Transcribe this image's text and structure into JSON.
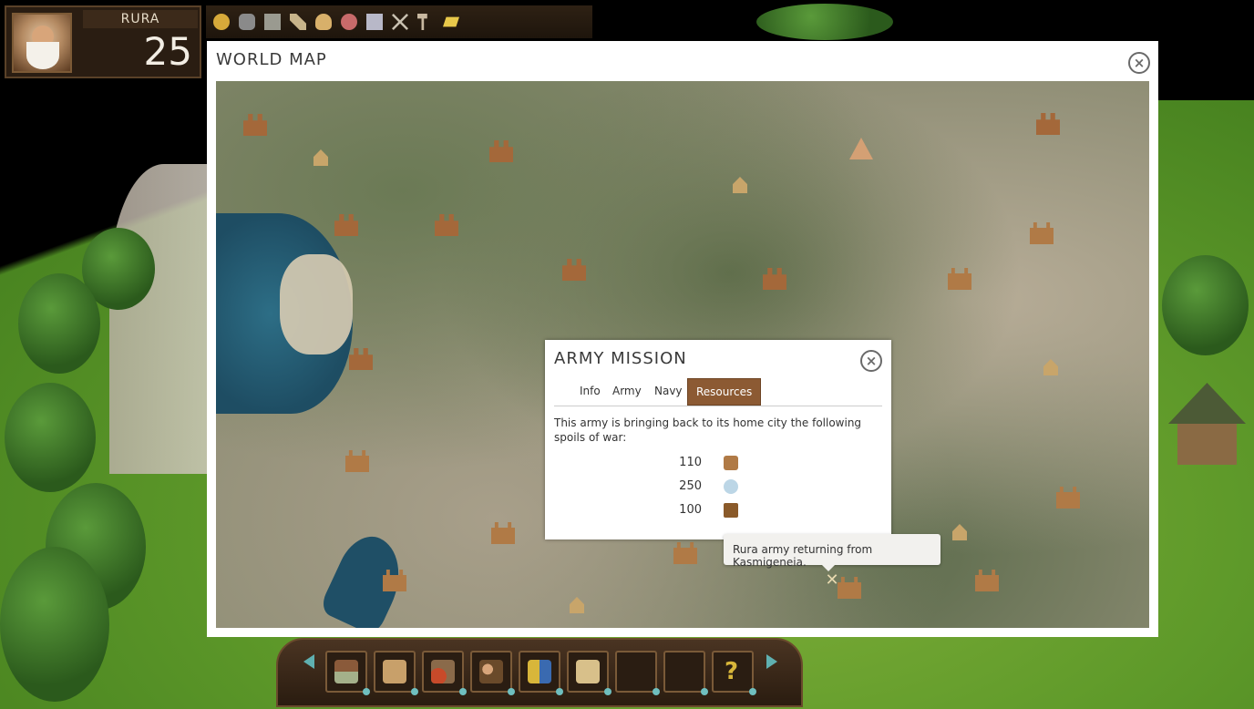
{
  "player": {
    "name": "RURA",
    "level": "25"
  },
  "resources": [
    {
      "icon": "gold-ore-icon",
      "color": "#d6a93a"
    },
    {
      "icon": "iron-ore-icon",
      "color": "#8a8a8a"
    },
    {
      "icon": "stone-icon",
      "color": "#9a9a90"
    },
    {
      "icon": "tools-icon",
      "color": "#c8b48a"
    },
    {
      "icon": "bread-icon",
      "color": "#d8b06a"
    },
    {
      "icon": "meat-icon",
      "color": "#c86a6a"
    },
    {
      "icon": "cloth-icon",
      "color": "#b8b8c8"
    },
    {
      "icon": "swords-icon",
      "color": "#c8c0b0"
    },
    {
      "icon": "hammer-icon",
      "color": "#c8b8a0"
    },
    {
      "icon": "gold-bar-icon",
      "color": "#e8c84a"
    }
  ],
  "world_map": {
    "title": "WORLD MAP"
  },
  "army_mission": {
    "title": "ARMY MISSION",
    "tabs": [
      {
        "label": "Info"
      },
      {
        "label": "Army"
      },
      {
        "label": "Navy"
      },
      {
        "label": "Resources"
      }
    ],
    "active_tab": "Resources",
    "description": "This army is bringing back to its home city the following spoils of war:",
    "spoils": [
      {
        "value": "110",
        "icon": "wood-icon"
      },
      {
        "value": "250",
        "icon": "silver-icon"
      },
      {
        "value": "100",
        "icon": "treasure-icon"
      }
    ]
  },
  "tooltip": {
    "text": "Rura army returning from Kasmigeneia."
  },
  "toolbar": {
    "slots": [
      {
        "icon": "city-icon"
      },
      {
        "icon": "crates-icon"
      },
      {
        "icon": "scroll-seal-icon"
      },
      {
        "icon": "advisors-icon"
      },
      {
        "icon": "trumpet-flag-icon"
      },
      {
        "icon": "map-scroll-icon"
      },
      {
        "icon": "empty-slot-icon"
      },
      {
        "icon": "empty-slot-icon"
      },
      {
        "icon": "help-icon",
        "label": "?"
      }
    ]
  },
  "colors": {
    "tab_active": "#8c5a33",
    "panel_dark": "#2a1d12",
    "gem": "#6fbfbf"
  }
}
